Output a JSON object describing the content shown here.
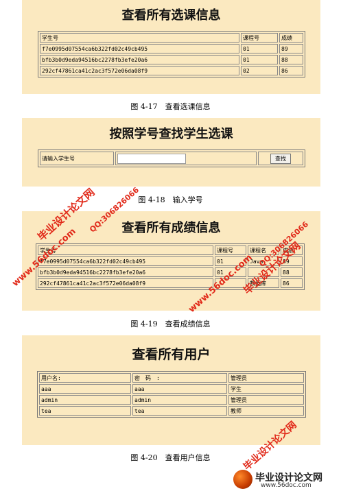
{
  "panel1": {
    "title": "查看所有选课信息",
    "headers": [
      "学生号",
      "课程号",
      "成绩"
    ],
    "rows": [
      [
        "f7e0995d07554ca6b322fd02c49cb495",
        "01",
        "89"
      ],
      [
        "bfb3b0d9eda94516bc2278fb3efe20a6",
        "01",
        "88"
      ],
      [
        "292cf47861ca41c2ac3f572e06da08f9",
        "02",
        "86"
      ]
    ]
  },
  "caption1": "图 4-17　查看选课信息",
  "panel2": {
    "title": "按照学号查找学生选课",
    "label": "请输入学生号",
    "button": "查找"
  },
  "caption2": "图 4-18　输入学号",
  "panel3": {
    "title": "查看所有成绩信息",
    "headers": [
      "学生号",
      "课程号",
      "课程名",
      "成绩"
    ],
    "rows": [
      [
        "f7e0995d07554ca6b322fd02c49cb495",
        "01",
        "Java",
        "89"
      ],
      [
        "bfb3b0d9eda94516bc2278fb3efe20a6",
        "01",
        "",
        "88"
      ],
      [
        "292cf47861ca41c2ac3f572e06da08f9",
        "",
        "数据库",
        "86"
      ]
    ]
  },
  "caption3": "图 4-19　查看成绩信息",
  "panel4": {
    "title": "查看所有用户",
    "headers": [
      "用户名:",
      "密　码　:",
      "管理员"
    ],
    "rows": [
      [
        "aaa",
        "aaa",
        "学生"
      ],
      [
        "admin",
        "admin",
        "管理员"
      ],
      [
        "tea",
        "tea",
        "教师"
      ]
    ]
  },
  "caption4": "图 4-20　查看用户信息",
  "watermarks": {
    "brand": "毕业设计论文网",
    "site": "www.56doc.com",
    "qq": "QQ:306826066",
    "footer_brand": "毕业设计论文网",
    "footer_site": "www.56doc.com"
  },
  "colors": {
    "panel_bg": "#fbe9c0",
    "watermark_red": "#e12a1a"
  }
}
